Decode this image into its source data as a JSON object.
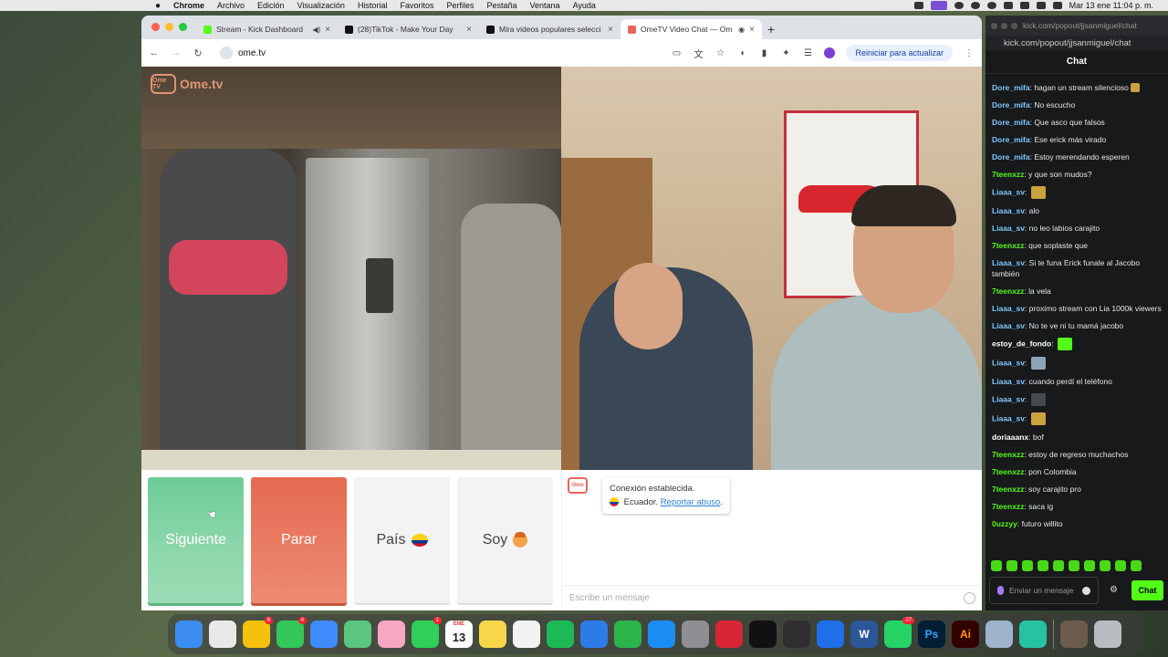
{
  "menubar": {
    "items": [
      "Chrome",
      "Archivo",
      "Edición",
      "Visualización",
      "Historial",
      "Favoritos",
      "Perfiles",
      "Pestaña",
      "Ventana",
      "Ayuda"
    ],
    "clock": "Mar 13 ene 11:04 p. m."
  },
  "browser": {
    "tabs": [
      {
        "title": "Stream - Kick Dashboard",
        "favicon": "kick-icon",
        "color": "#53fc18"
      },
      {
        "title": "(28)TikTok - Make Your Day",
        "favicon": "tiktok-icon",
        "color": "#111111"
      },
      {
        "title": "Mira videos populares selecci",
        "favicon": "tiktok-icon",
        "color": "#111111"
      },
      {
        "title": "OmeTV Video Chat — Om",
        "favicon": "ometv-icon",
        "color": "#e7665a"
      }
    ],
    "url": "ome.tv",
    "update_button": "Reiniciar para actualizar"
  },
  "ometv": {
    "logo_text": "Ome.tv",
    "logo_badge": "Ome TV",
    "buttons": {
      "next": "Siguiente",
      "stop": "Parar",
      "country": "País",
      "gender": "Soy"
    },
    "system_message": {
      "connected": "Conexión establecida.",
      "country": "Ecuador.",
      "report": "Reportar abuso"
    },
    "input_placeholder": "Escribe un mensaje"
  },
  "kick": {
    "popout_title": "kick.com/popout/jjsanmiguel/chat",
    "url": "kick.com/popout/jjsanmiguel/chat",
    "chat_title": "Chat",
    "messages": [
      {
        "user": "Dore_mifa",
        "text": "hagan un stream silencioso",
        "color": "#7ec8ff",
        "emote": true
      },
      {
        "user": "Dore_mifa",
        "text": "No escucho",
        "color": "#7ec8ff"
      },
      {
        "user": "Dore_mifa",
        "text": "Que asco que falsos",
        "color": "#7ec8ff"
      },
      {
        "user": "Dore_mifa",
        "text": "Ese erick más virado",
        "color": "#7ec8ff"
      },
      {
        "user": "Dore_mifa",
        "text": "Estoy merendando esperen",
        "color": "#7ec8ff"
      },
      {
        "user": "7teenxzz",
        "text": "y que son mudos?",
        "color": "#53fc18"
      },
      {
        "user": "Liaaa_sv",
        "text": "",
        "color": "#7ec8ff",
        "emote": true
      },
      {
        "user": "Liaaa_sv",
        "text": "alo",
        "color": "#7ec8ff"
      },
      {
        "user": "Liaaa_sv",
        "text": "no leo labios carajito",
        "color": "#7ec8ff"
      },
      {
        "user": "7teenxzz",
        "text": "que soplaste que",
        "color": "#53fc18"
      },
      {
        "user": "Liaaa_sv",
        "text": "Si te funa Erick funale al Jacobo también",
        "color": "#7ec8ff"
      },
      {
        "user": "7teenxzz",
        "text": "la vela",
        "color": "#53fc18"
      },
      {
        "user": "Liaaa_sv",
        "text": "proximo stream con Lia 1000k viewers",
        "color": "#7ec8ff"
      },
      {
        "user": "Liaaa_sv",
        "text": "No te ve ni tu mamá jacobo",
        "color": "#7ec8ff"
      },
      {
        "user": "estoy_de_fondo",
        "text": "",
        "color": "#ffffff",
        "emote": true
      },
      {
        "user": "Liaaa_sv",
        "text": "",
        "color": "#7ec8ff",
        "emote": true
      },
      {
        "user": "Liaaa_sv",
        "text": "cuando perdí el teléfono",
        "color": "#7ec8ff"
      },
      {
        "user": "Liaaa_sv",
        "text": "",
        "color": "#7ec8ff",
        "emote": true
      },
      {
        "user": "Liaaa_sv",
        "text": "",
        "color": "#7ec8ff",
        "emote": true
      },
      {
        "user": "doriaaanx",
        "text": "bof",
        "color": "#ffffff"
      },
      {
        "user": "7teenxzz",
        "text": "estoy de regreso muchachos",
        "color": "#53fc18"
      },
      {
        "user": "7teenxzz",
        "text": "pon Colombia",
        "color": "#53fc18"
      },
      {
        "user": "7teenxzz",
        "text": "soy carajito pro",
        "color": "#53fc18"
      },
      {
        "user": "7teenxzz",
        "text": "saca ig",
        "color": "#53fc18"
      },
      {
        "user": "0uzzyy",
        "text": "futuro willito",
        "color": "#53fc18"
      }
    ],
    "input_placeholder": "Enviar un mensaje",
    "send_button": "Chat"
  },
  "dock": {
    "apps": [
      {
        "name": "finder-icon",
        "color": "#3b8ef0"
      },
      {
        "name": "launchpad-icon",
        "color": "#e9e9e9"
      },
      {
        "name": "chrome-icon",
        "color": "#f4c20d",
        "badge": "6"
      },
      {
        "name": "messages-icon",
        "color": "#34c759",
        "badge": "4"
      },
      {
        "name": "mail-icon",
        "color": "#3f8cff"
      },
      {
        "name": "maps-icon",
        "color": "#5bc67d"
      },
      {
        "name": "photos-icon",
        "color": "#f7a6c4"
      },
      {
        "name": "facetime-icon",
        "color": "#2fcf5a",
        "badge": "1"
      },
      {
        "name": "calendar-icon",
        "color": "#ffffff",
        "label": "13",
        "month": "ENE"
      },
      {
        "name": "notes-icon",
        "color": "#f7d64a"
      },
      {
        "name": "freeform-icon",
        "color": "#f2f2f2"
      },
      {
        "name": "spotify-icon",
        "color": "#1db954"
      },
      {
        "name": "keynote-icon",
        "color": "#2d7be6"
      },
      {
        "name": "numbers-icon",
        "color": "#2bb44a"
      },
      {
        "name": "app-store-icon",
        "color": "#1b8cf2"
      },
      {
        "name": "system-settings-icon",
        "color": "#8e8e93"
      },
      {
        "name": "photo-booth-icon",
        "color": "#d82634"
      },
      {
        "name": "capcut-icon",
        "color": "#111111"
      },
      {
        "name": "obs-icon",
        "color": "#302e31"
      },
      {
        "name": "xcode-icon",
        "color": "#1f6feb"
      },
      {
        "name": "word-icon",
        "color": "#2b579a",
        "label": "W"
      },
      {
        "name": "whatsapp-icon",
        "color": "#25d366",
        "badge": "27"
      },
      {
        "name": "photoshop-icon",
        "color": "#001e36",
        "label": "Ps"
      },
      {
        "name": "illustrator-icon",
        "color": "#330000",
        "label": "Ai"
      },
      {
        "name": "preview-icon",
        "color": "#9fb4cc"
      },
      {
        "name": "screen-recorder-icon",
        "color": "#27c3a1"
      },
      {
        "name": "downloads-folder-icon",
        "color": "#6b5c4d"
      },
      {
        "name": "trash-icon",
        "color": "#b9bcc0"
      }
    ]
  }
}
